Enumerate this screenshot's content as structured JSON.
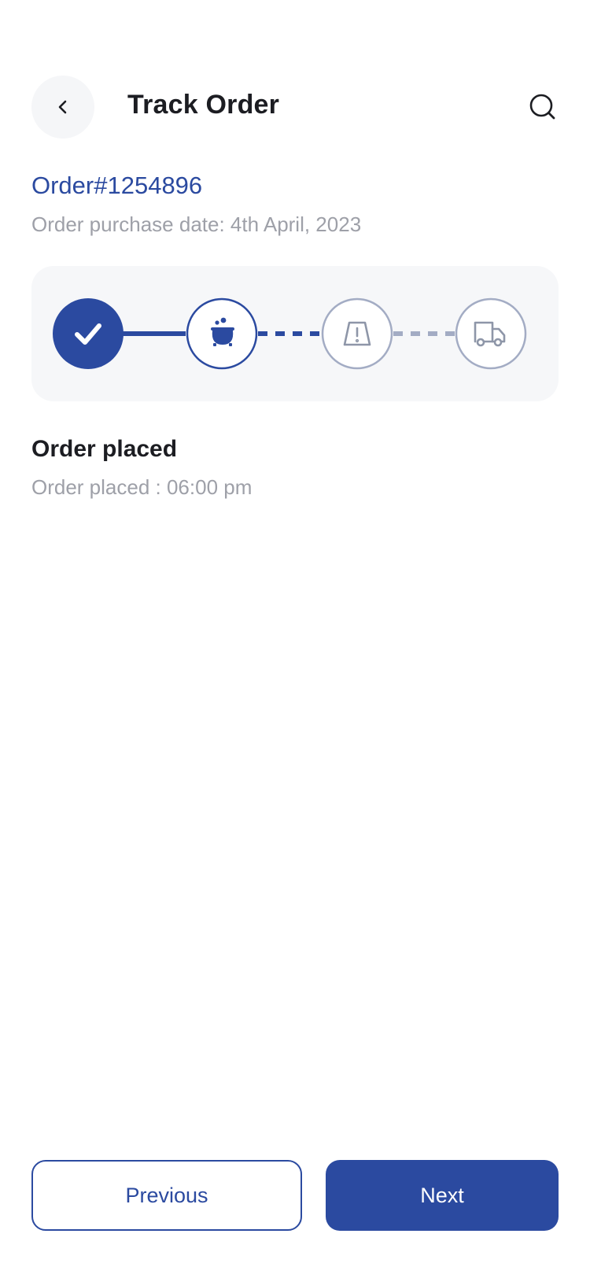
{
  "header": {
    "title": "Track Order",
    "back_icon": "chevron-left-icon",
    "search_icon": "search-icon"
  },
  "order": {
    "number": "Order#1254896",
    "purchase_date": "Order purchase date: 4th April, 2023"
  },
  "tracker": {
    "steps": [
      {
        "icon": "check-icon",
        "state": "completed"
      },
      {
        "icon": "cooking-pot-icon",
        "state": "current"
      },
      {
        "icon": "road-warning-icon",
        "state": "pending"
      },
      {
        "icon": "delivery-truck-icon",
        "state": "pending"
      }
    ],
    "colors": {
      "accent": "#2b4aa0",
      "pending": "#a3acc4",
      "panel": "#f6f7f9"
    }
  },
  "status": {
    "title": "Order placed",
    "time": "Order placed : 06:00 pm"
  },
  "actions": {
    "previous_label": "Previous",
    "next_label": "Next"
  }
}
